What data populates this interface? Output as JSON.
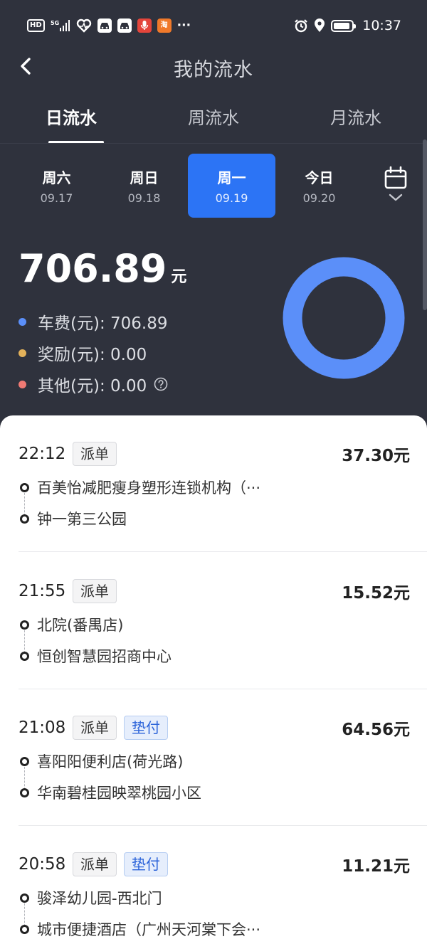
{
  "status_bar": {
    "left_icons": [
      "HD",
      "5G signal",
      "heart",
      "car",
      "car",
      "mic",
      "淘"
    ],
    "more": "···",
    "time": "10:37"
  },
  "header": {
    "title": "我的流水"
  },
  "tabs": [
    {
      "label": "日流水",
      "active": true
    },
    {
      "label": "周流水",
      "active": false
    },
    {
      "label": "月流水",
      "active": false
    }
  ],
  "dates": [
    {
      "weekday": "周六",
      "date": "09.17",
      "selected": false
    },
    {
      "weekday": "周日",
      "date": "09.18",
      "selected": false
    },
    {
      "weekday": "周一",
      "date": "09.19",
      "selected": true
    },
    {
      "weekday": "今日",
      "date": "09.20",
      "selected": false
    }
  ],
  "summary": {
    "total": "706.89",
    "unit": "元",
    "items": [
      {
        "label": "车费(元): 706.89",
        "color": "#5b8ff9"
      },
      {
        "label": "奖励(元): 0.00",
        "color": "#e3b15a"
      },
      {
        "label": "其他(元): 0.00",
        "color": "#f07a74"
      }
    ],
    "donut_color": "#5b8ff9"
  },
  "orders": [
    {
      "time": "22:12",
      "tags": [
        "派单"
      ],
      "amount": "37.30元",
      "from": "百美怡减肥瘦身塑形连锁机构（···",
      "to": "钟一第三公园"
    },
    {
      "time": "21:55",
      "tags": [
        "派单"
      ],
      "amount": "15.52元",
      "from": "北院(番禺店)",
      "to": "恒创智慧园招商中心"
    },
    {
      "time": "21:08",
      "tags": [
        "派单",
        "垫付"
      ],
      "amount": "64.56元",
      "from": "喜阳阳便利店(荷光路)",
      "to": "华南碧桂园映翠桃园小区"
    },
    {
      "time": "20:58",
      "tags": [
        "派单",
        "垫付"
      ],
      "amount": "11.21元",
      "from": "骏泽幼儿园-西北门",
      "to": "城市便捷酒店（广州天河棠下会···"
    }
  ]
}
